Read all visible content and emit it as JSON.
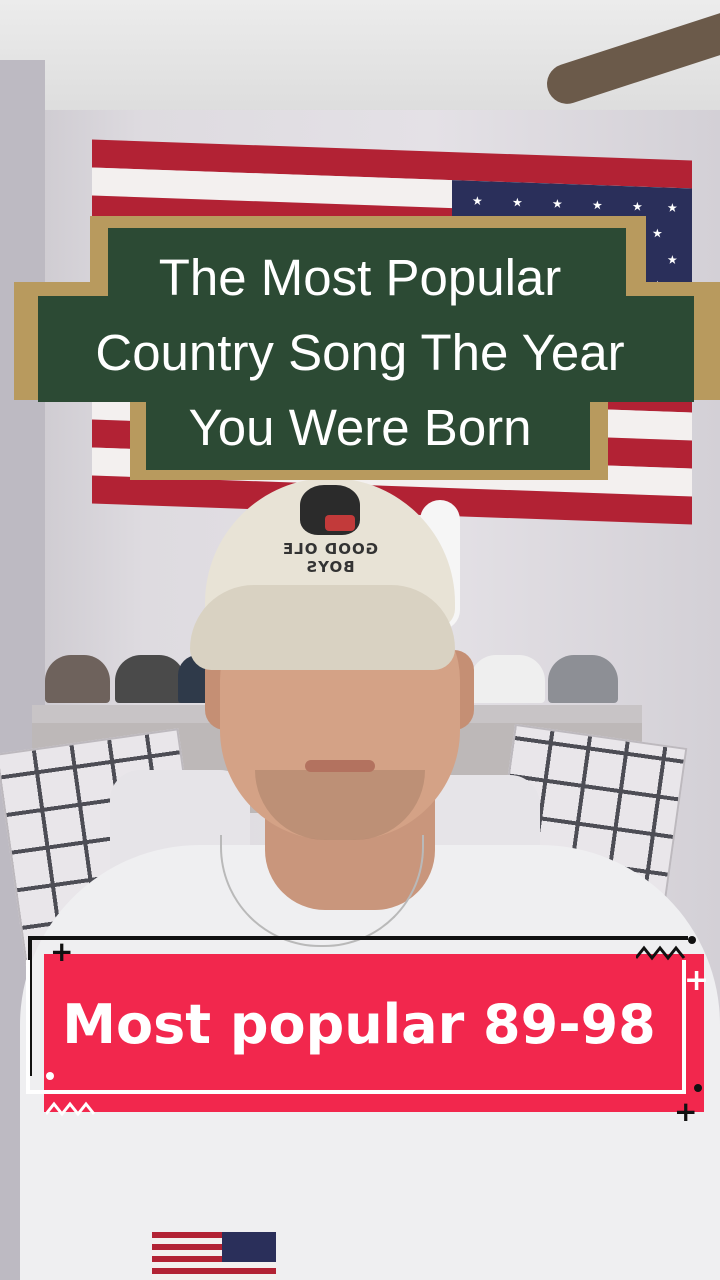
{
  "overlay": {
    "title_lines": [
      "The Most Popular",
      "Country Song The Year",
      "You Were Born"
    ],
    "caption": "Most popular 89-98"
  },
  "hat": {
    "brand_text": "GOOD OLE BOYS"
  },
  "colors": {
    "title_box": "#2c4a34",
    "title_border": "#b89a5e",
    "caption_bg": "#f2274d",
    "caption_text": "#ffffff"
  }
}
